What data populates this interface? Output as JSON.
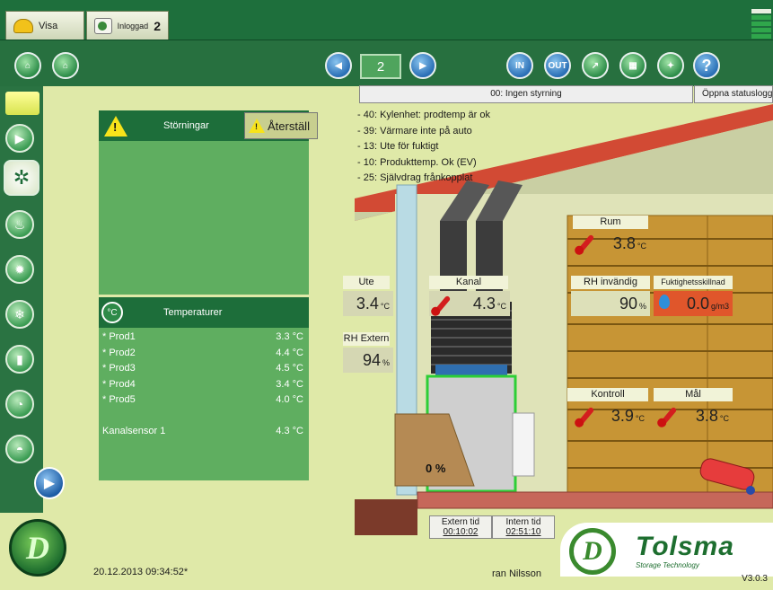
{
  "tabs": [
    {
      "label": "Visa",
      "icon": "helmet-icon"
    },
    {
      "label": "Inloggad",
      "count": "2",
      "icon": "login-icon"
    }
  ],
  "toolbar": {
    "page_number": "2",
    "in_label": "IN",
    "out_label": "OUT",
    "help_label": "?"
  },
  "status": {
    "mode_text": "00: Ingen styrning",
    "log_button": "Öppna statuslogg"
  },
  "log_messages": [
    "- 40: Kylenhet: prodtemp är ok",
    "- 39: Värmare inte på auto",
    "- 13: Ute för fuktigt",
    "- 10: Produkttemp. Ok (EV)",
    "- 25: Självdrag frånkopplat"
  ],
  "alarm_panel": {
    "title": "Störningar",
    "reset_button": "Återställ"
  },
  "temp_panel": {
    "title": "Temperaturer",
    "icon_text": "°C",
    "rows": [
      {
        "name": "* Prod1",
        "value": "3.3 °C"
      },
      {
        "name": "* Prod2",
        "value": "4.4 °C"
      },
      {
        "name": "* Prod3",
        "value": "4.5 °C"
      },
      {
        "name": "* Prod4",
        "value": "3.4 °C"
      },
      {
        "name": "* Prod5",
        "value": "4.0 °C"
      },
      {
        "name": "",
        "value": ""
      },
      {
        "name": "Kanalsensor 1",
        "value": "4.3 °C"
      }
    ]
  },
  "readings": {
    "ute": {
      "label": "Ute",
      "value": "3.4",
      "unit": "°C"
    },
    "rh_extern": {
      "label": "RH Extern",
      "value": "94",
      "unit": "%"
    },
    "kanal": {
      "label": "Kanal",
      "value": "4.3",
      "unit": "°C"
    },
    "rum": {
      "label": "Rum",
      "value": "3.8",
      "unit": "°C"
    },
    "rh_invandig": {
      "label": "RH invändig",
      "value": "90",
      "unit": "%"
    },
    "fukt": {
      "label": "Fuktighetsskillnad",
      "value": "0.0",
      "unit": "g/m3"
    },
    "kontroll": {
      "label": "Kontroll",
      "value": "3.9",
      "unit": "°C"
    },
    "mal": {
      "label": "Mål",
      "value": "3.8",
      "unit": "°C"
    },
    "damper": "0 %"
  },
  "timers": {
    "extern": {
      "label": "Extern tid",
      "value": "00:10:02"
    },
    "intern": {
      "label": "Intern tid",
      "value": "02:51:10"
    }
  },
  "footer": {
    "datetime": "20.12.2013 09:34:52*",
    "user": "ran Nilsson",
    "brand": "Tolsma",
    "tagline": "Storage Technology",
    "version": "V3.0.3"
  },
  "colors": {
    "primary_green": "#1d6e3a",
    "panel_green": "#5fae60",
    "background": "#dfe9a8",
    "alarm_yellow": "#f7e31a",
    "fukt_red": "#e0562b"
  }
}
